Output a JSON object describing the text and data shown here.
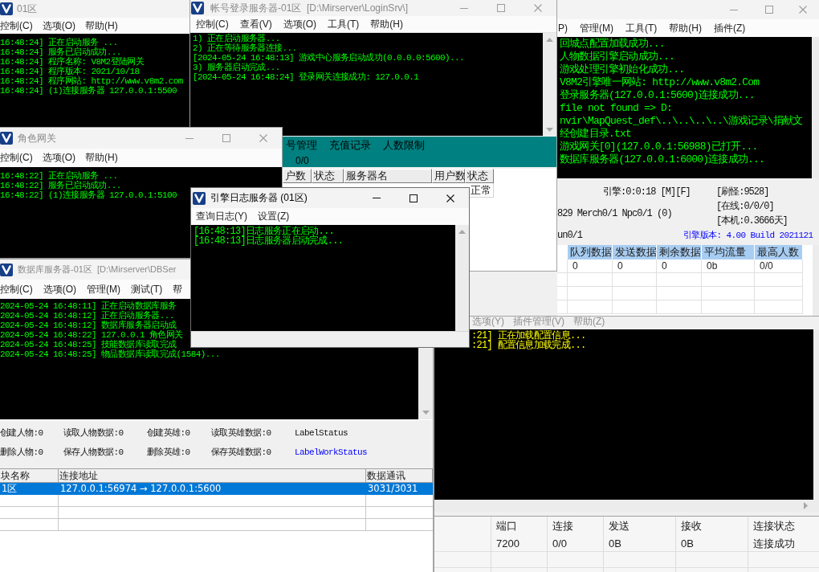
{
  "login_gate_window": {
    "title": "01区",
    "active": false,
    "menu": [
      "控制(C)",
      "选项(O)",
      "帮助(H)"
    ],
    "log": [
      "16:48:24] 正在启动服务 ...",
      "16:48:24] 服务已启动成功...",
      "16:48:24] 程序名称: V8M2登陆网关",
      "16:48:24] 程序版本: 2021/10/18",
      "16:48:24] 程序网站: http://www.v8m2.com",
      "16:48:24] (1)连接服务器 127.0.0.1:5500"
    ]
  },
  "login_server_window": {
    "title": "帐号登录服务器-01区  [D:\\Mirserver\\LoginSrv\\]",
    "active": false,
    "menu": [
      "控制(C)",
      "查看(V)",
      "选项(O)",
      "工具(T)",
      "帮助(H)"
    ],
    "log": [
      "1) 正在启动服务器...",
      "2) 正在等待服务器连接...",
      "[2024-05-24 16:48:13] 游戏中心服务启动成功(0.0.0.0:5600)...",
      "3) 服务器启动完成...",
      "[2024-05-24 16:48:24] 登录网关连接成功: 127.0.0.1"
    ],
    "panel_menu": [
      "号管理",
      "充值记录",
      "人数限制"
    ],
    "count": "0/0",
    "table": {
      "columns": [
        "户数",
        "状态",
        "服务器名",
        "用户数",
        "状态"
      ],
      "status_cell": "正常"
    }
  },
  "engine_window": {
    "active": false,
    "menu": [
      "P)",
      "管理(M)",
      "工具(T)",
      "帮助(H)",
      "插件(Z)"
    ],
    "log": [
      "回城点配置加载成功...",
      "人物数据引擎启动成功...",
      "游戏处理引擎初始化成功...",
      "V8M2引擎唯一网站: http://www.v8m2.Com",
      "登录服务器(127.0.0.1:5600)连接成功...",
      "file not found => D:",
      "nvir\\MapQuest_def\\..\\..\\..\\..\\游戏记录\\捐献文",
      "经创建目录.txt",
      "游戏网关[0](127.0.0.1:56988)已打开...",
      "数据库服务器(127.0.0.1:6000)连接成功..."
    ],
    "status": {
      "top_center": "引擎:0:0:18 [M][F]",
      "top_right": "[刷怪:9528]",
      "middle_right": "[在线:0/0/0]",
      "middle_left": "829 Merch0/1 Npc0/1 (0)",
      "lower_right": "[本机:0.3666天]",
      "bottom_left": "un0/1",
      "bottom_right": "引擎版本: 4.00 Build 2021121"
    },
    "table": {
      "columns": [
        "队列数据",
        "发送数据",
        "剩余数据",
        "平均流量",
        "最高人数"
      ],
      "rows": [
        [
          "0",
          "0",
          "0",
          "0b",
          "0/0"
        ]
      ]
    }
  },
  "role_gate_window": {
    "title": "角色网关",
    "active": false,
    "menu": [
      "控制(C)",
      "选项(O)",
      "帮助(H)"
    ],
    "log": [
      "16:48:22] 正在启动服务 ...",
      "16:48:22] 服务已启动成功...",
      "16:48:22] (1)连接服务器 127.0.0.1:5100"
    ]
  },
  "log_server_window": {
    "title": "引擎日志服务器 (01区)",
    "active": true,
    "menu": [
      "查询日志(Y)",
      "设置(Z)"
    ],
    "log": [
      "[16:48:13]日志服务正在启动...",
      "[16:48:13]日志服务器启动完成..."
    ]
  },
  "db_server_window": {
    "title": "数据库服务器-01区  [D:\\Mirserver\\DBSer",
    "active": false,
    "menu": [
      "控制(C)",
      "选项(O)",
      "管理(M)",
      "测试(T)",
      "帮"
    ],
    "log": [
      "2024-05-24 16:48:11] 正在启动数据库服务",
      "2024-05-24 16:48:12] 正在启动服务器...",
      "2024-05-24 16:48:12] 数据库服务器启动成",
      "2024-05-24 16:48:22] 127.0.0.1 角色网关",
      "2024-05-24 16:48:25] 技能数据库读取完成",
      "2024-05-24 16:48:25] 物品数据库读取完成(1584)..."
    ],
    "stats": [
      [
        "创建人物:0",
        "读取人物数据:0",
        "创建英雄:0",
        "读取英雄数据:0",
        "LabelStatus"
      ],
      [
        "删除人物:0",
        "保存人物数据:0",
        "删除英雄:0",
        "保存英雄数据:0",
        "LabelWorkStatus"
      ]
    ],
    "table": {
      "columns": [
        "块名称",
        "连接地址",
        "数据通讯"
      ],
      "rows": [
        {
          "cells": [
            "1区",
            "127.0.0.1:56974 → 127.0.0.1:5600",
            "3031/3031"
          ],
          "selected": true
        }
      ]
    }
  },
  "run_gate_window": {
    "menu": [
      "选项(Y)",
      "插件管理(V)",
      "帮助(Z)"
    ],
    "log": [
      ":21] 正在加载配置信息...",
      ":21] 配置信息加载完成..."
    ],
    "table": {
      "columns": [
        "端口",
        "连接",
        "发送",
        "接收",
        "连接状态"
      ],
      "rows": [
        [
          "7200",
          "0/0",
          "0B",
          "0B",
          "连接成功"
        ]
      ]
    }
  }
}
